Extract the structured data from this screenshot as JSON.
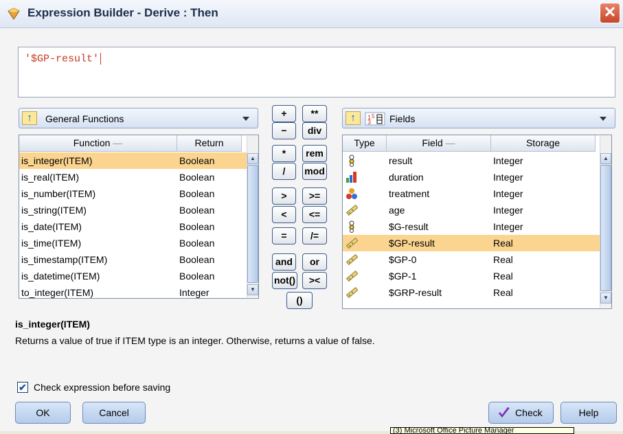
{
  "window": {
    "title": "Expression Builder - Derive : Then",
    "close_glyph": "✕"
  },
  "editor": {
    "expression": "'$GP-result'"
  },
  "functions": {
    "category": "General Functions",
    "columns": [
      "Function",
      "Return"
    ],
    "rows": [
      {
        "name": "is_integer(ITEM)",
        "ret": "Boolean",
        "selected": true
      },
      {
        "name": "is_real(ITEM)",
        "ret": "Boolean"
      },
      {
        "name": "is_number(ITEM)",
        "ret": "Boolean"
      },
      {
        "name": "is_string(ITEM)",
        "ret": "Boolean"
      },
      {
        "name": "is_date(ITEM)",
        "ret": "Boolean"
      },
      {
        "name": "is_time(ITEM)",
        "ret": "Boolean"
      },
      {
        "name": "is_timestamp(ITEM)",
        "ret": "Boolean"
      },
      {
        "name": "is_datetime(ITEM)",
        "ret": "Boolean"
      },
      {
        "name": "to_integer(ITEM)",
        "ret": "Integer"
      }
    ]
  },
  "operators": {
    "plus": "+",
    "power": "**",
    "minus": "−",
    "div": "div",
    "times": "*",
    "rem": "rem",
    "slash": "/",
    "mod": "mod",
    "gt": ">",
    "gte": ">=",
    "lt": "<",
    "lte": "<=",
    "eq": "=",
    "neq": "/=",
    "and": "and",
    "or": "or",
    "not": "not()",
    "join": "><",
    "parens": "()"
  },
  "fields": {
    "category": "Fields",
    "columns": [
      "Type",
      "Field",
      "Storage"
    ],
    "rows": [
      {
        "type_icon": "flag-icon",
        "field": "result",
        "storage": "Integer"
      },
      {
        "type_icon": "ordinal-icon",
        "field": "duration",
        "storage": "Integer"
      },
      {
        "type_icon": "nominal-icon",
        "field": "treatment",
        "storage": "Integer"
      },
      {
        "type_icon": "continuous-icon",
        "field": "age",
        "storage": "Integer"
      },
      {
        "type_icon": "flag-icon",
        "field": "$G-result",
        "storage": "Integer"
      },
      {
        "type_icon": "continuous-icon",
        "field": "$GP-result",
        "storage": "Real",
        "selected": true
      },
      {
        "type_icon": "continuous-icon",
        "field": "$GP-0",
        "storage": "Real"
      },
      {
        "type_icon": "continuous-icon",
        "field": "$GP-1",
        "storage": "Real"
      },
      {
        "type_icon": "continuous-icon",
        "field": "$GRP-result",
        "storage": "Real"
      }
    ]
  },
  "description": {
    "title": "is_integer(ITEM)",
    "text": "Returns a value of true if ITEM type is an integer. Otherwise, returns a value of false."
  },
  "check_before_saving": {
    "label": "Check expression before saving",
    "checked": true
  },
  "buttons": {
    "ok": "OK",
    "cancel": "Cancel",
    "check": "Check",
    "help": "Help"
  },
  "tooltip": "(3) Microsoft Office Picture Manager",
  "colors": {
    "selection": "#fbd590",
    "expression_text": "#c43a1c"
  }
}
